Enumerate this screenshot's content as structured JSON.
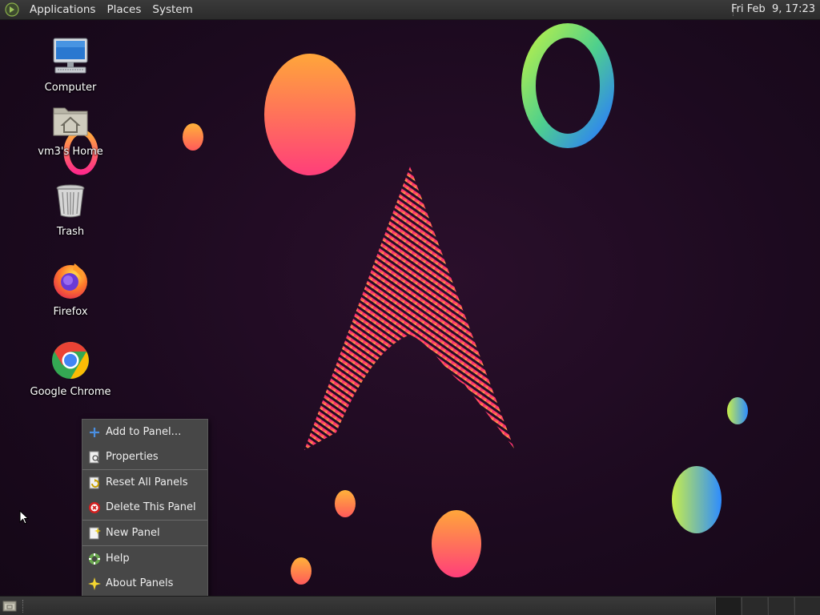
{
  "top_panel": {
    "menus": [
      "Applications",
      "Places",
      "System"
    ],
    "clock": "Fri Feb  9, 17:23"
  },
  "desktop_icons": [
    {
      "label": "Computer",
      "icon": "computer-icon"
    },
    {
      "label": "vm3's Home",
      "icon": "home-folder-icon"
    },
    {
      "label": "Trash",
      "icon": "trash-icon"
    },
    {
      "label": "Firefox",
      "icon": "firefox-icon"
    },
    {
      "label": "Google Chrome",
      "icon": "chrome-icon"
    }
  ],
  "context_menu": {
    "items": [
      {
        "label": "Add to Panel…",
        "icon": "plus-icon"
      },
      {
        "label": "Properties",
        "icon": "properties-icon"
      },
      {
        "label": "Reset All Panels",
        "icon": "reset-icon"
      },
      {
        "label": "Delete This Panel",
        "icon": "delete-icon"
      },
      {
        "label": "New Panel",
        "icon": "new-panel-icon"
      },
      {
        "label": "Help",
        "icon": "help-icon"
      },
      {
        "label": "About Panels",
        "icon": "about-icon"
      }
    ]
  },
  "colors": {
    "panel_bg": "#2e2e2e",
    "menu_bg": "#474747",
    "desktop_bg": "#1c0a1f",
    "accent_pink": "#ff2a7a",
    "accent_orange": "#ffa040"
  }
}
